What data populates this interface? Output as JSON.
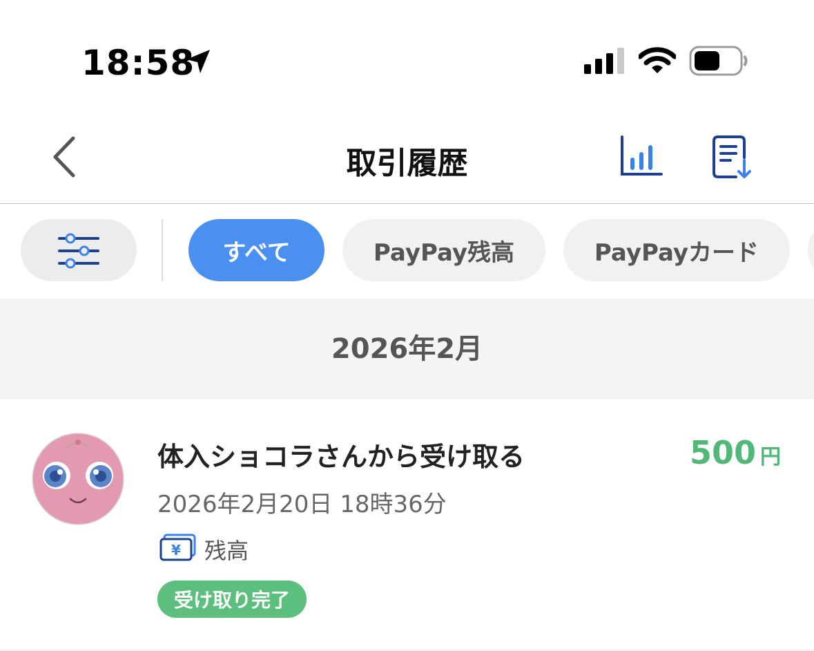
{
  "status_bar": {
    "time": "18:58",
    "icons": [
      "location-arrow-icon",
      "cellular-signal-icon",
      "wifi-icon",
      "battery-icon"
    ]
  },
  "header": {
    "title": "取引履歴",
    "icons": [
      "back-chevron-icon",
      "bar-chart-icon",
      "document-download-icon"
    ],
    "accent_color": "#1c3f8f"
  },
  "filters": {
    "filter_icon": "sliders-icon",
    "chips": [
      {
        "label": "すべて",
        "active": true
      },
      {
        "label": "PayPay残高",
        "active": false
      },
      {
        "label": "PayPayカード",
        "active": false
      }
    ],
    "active_color": "#4a90f0"
  },
  "month": {
    "label": "2026年2月"
  },
  "transactions": [
    {
      "title": "体入ショコラさんから受け取る",
      "amount": "500",
      "currency": "円",
      "datetime": "2026年2月20日 18時36分",
      "method_icon": "yen-bill-icon",
      "method_label": "残高",
      "status": "受け取り完了",
      "amount_color": "#52b878",
      "status_color": "#5cbf7e"
    }
  ]
}
